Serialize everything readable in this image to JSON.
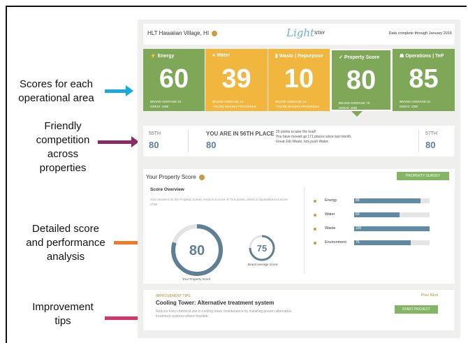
{
  "callouts": [
    {
      "text": "Scores for each\noperational area",
      "color": "#1aa9dd"
    },
    {
      "text": "Friendly\ncompetition\nacross\nproperties",
      "color": "#8a2a66"
    },
    {
      "text": "Detailed score\nand performance\nanalysis",
      "color": "#ee7a2c"
    },
    {
      "text": "Improvement\ntips",
      "color": "#d9346a"
    }
  ],
  "header": {
    "property_name": "HLT Hawaiian Village, HI",
    "logo_light": "Light",
    "logo_stay": "STAY",
    "data_complete": "Data complete through January 2016"
  },
  "tiles": [
    {
      "label": "Energy",
      "icon": "bolt-icon",
      "score": "60",
      "sub1": "BRAND AVERAGE  52",
      "sub2": "GREAT JOB!",
      "color": "#7ea858"
    },
    {
      "label": "Water",
      "icon": "water-drop-icon",
      "score": "39",
      "sub1": "BRAND AVERAGE  15",
      "sub2": "YOU'RE MAKING PROGRESS",
      "color": "#f0b63e"
    },
    {
      "label": "Waste | Repurpose",
      "icon": "trash-icon",
      "score": "10",
      "sub1": "BRAND AVERAGE  15",
      "sub2": "YOU'RE MAKING PROGRESS",
      "color": "#f0b63e"
    },
    {
      "label": "Property Score",
      "icon": "check-circle-icon",
      "score": "80",
      "sub1": "BRAND AVERAGE  75",
      "sub2": "GREAT JOB!",
      "color": "#7ea858"
    },
    {
      "label": "Operations | TeP",
      "icon": "people-icon",
      "score": "85",
      "sub1": "BRAND AVERAGE  61",
      "sub2": "GREAT JOB!",
      "color": "#7ea858"
    }
  ],
  "competition": {
    "left_rank": "55TH",
    "left_value": "80",
    "place_text": "YOU ARE IN 56TH PLACE",
    "place_value": "80",
    "message": "20 points to take the lead!\nYou have moved up 171 places since last month.\nGreat Job Waste, lets push Water.",
    "right_rank": "57TH",
    "right_value": "80"
  },
  "score_panel": {
    "title": "Your Property Score",
    "survey_button": "PROPERTY SURVEY",
    "overview_title": "Score Overview",
    "description": "Your answers on the Property Survey result in a score of 75.5 points, which is equivalent to a score of 80.",
    "property_score": "80",
    "property_score_fraction": 0.8,
    "property_score_caption": "Your Property Score",
    "brand_average": "75",
    "brand_average_fraction": 0.75,
    "brand_average_caption": "Brand average Score",
    "bars": [
      {
        "label": "Energy",
        "value": "88",
        "fraction": 0.88
      },
      {
        "label": "Water",
        "value": "60",
        "fraction": 0.6
      },
      {
        "label": "Waste",
        "value": "100",
        "fraction": 1.0
      },
      {
        "label": "Environment",
        "value": "75",
        "fraction": 0.75
      }
    ]
  },
  "tips": {
    "label": "IMPROVEMENT TIPS",
    "title": "Cooling Tower: Alternative treatment system",
    "description": "Reduce toxic chemical use in cooling tower maintenance by installing proven alternative treatment systems where feasible.",
    "nav": "Prev  Next",
    "start_button": "START PROJECT"
  }
}
